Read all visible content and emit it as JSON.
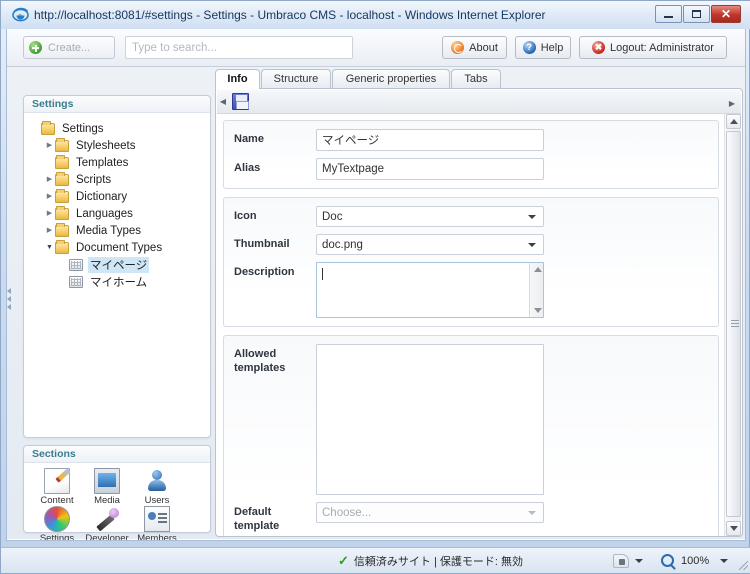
{
  "window": {
    "title": "http://localhost:8081/#settings - Settings - Umbraco CMS - localhost - Windows Internet Explorer",
    "buttons": {
      "minimize": "Minimize",
      "maximize": "Restore",
      "close": "Close"
    }
  },
  "toolbar": {
    "create_label": "Create...",
    "search_placeholder": "Type to search...",
    "search_value": "",
    "about_label": "About",
    "help_label": "Help",
    "help_glyph": "?",
    "logout_label": "Logout: Administrator",
    "logout_glyph": "✖"
  },
  "sidebar": {
    "tree_header": "Settings",
    "nodes": [
      {
        "label": "Settings",
        "indent": 0,
        "arrow": "",
        "icon": "folder-icon"
      },
      {
        "label": "Stylesheets",
        "indent": 1,
        "arrow": "▶",
        "icon": "folder-icon"
      },
      {
        "label": "Templates",
        "indent": 1,
        "arrow": "",
        "icon": "folder-icon"
      },
      {
        "label": "Scripts",
        "indent": 1,
        "arrow": "▶",
        "icon": "folder-icon"
      },
      {
        "label": "Dictionary",
        "indent": 1,
        "arrow": "▶",
        "icon": "folder-icon"
      },
      {
        "label": "Languages",
        "indent": 1,
        "arrow": "▶",
        "icon": "folder-icon"
      },
      {
        "label": "Media Types",
        "indent": 1,
        "arrow": "▶",
        "icon": "folder-icon"
      },
      {
        "label": "Document Types",
        "indent": 1,
        "arrow": "▼",
        "icon": "folder-icon"
      },
      {
        "label": "マイページ",
        "indent": 2,
        "arrow": "",
        "icon": "document-type-icon",
        "selected": true
      },
      {
        "label": "マイホーム",
        "indent": 2,
        "arrow": "",
        "icon": "document-type-icon"
      }
    ],
    "sections_header": "Sections",
    "sections": [
      {
        "label": "Content",
        "icon": "content-icon"
      },
      {
        "label": "Media",
        "icon": "media-icon"
      },
      {
        "label": "Users",
        "icon": "users-icon"
      },
      {
        "label": "Settings",
        "icon": "settings-icon"
      },
      {
        "label": "Developer",
        "icon": "developer-icon"
      },
      {
        "label": "Members",
        "icon": "members-icon"
      }
    ]
  },
  "main": {
    "tabs": [
      {
        "label": "Info",
        "active": true
      },
      {
        "label": "Structure",
        "active": false
      },
      {
        "label": "Generic properties",
        "active": false
      },
      {
        "label": "Tabs",
        "active": false
      }
    ],
    "save_bar": {
      "save_icon": "save-icon",
      "left_arrow": "◀",
      "right_arrow": "▶"
    },
    "fields": {
      "name_label": "Name",
      "name_value": "マイページ",
      "alias_label": "Alias",
      "alias_value": "MyTextpage",
      "icon_label": "Icon",
      "icon_value": "Doc",
      "thumbnail_label": "Thumbnail",
      "thumbnail_value": "doc.png",
      "description_label": "Description",
      "description_value": "",
      "allowed_templates_label": "Allowed templates",
      "allowed_templates_items": [],
      "default_template_label": "Default template",
      "default_template_value": "Choose..."
    }
  },
  "statusbar": {
    "zone_text": "信頼済みサイト | 保護モード: 無効",
    "check_glyph": "✓",
    "zoom_level": "100%"
  },
  "colors": {
    "accent": "#3a7d8c",
    "selection": "#cfe6f7",
    "title_text": "#17365d",
    "close_button": "#c0352a"
  }
}
